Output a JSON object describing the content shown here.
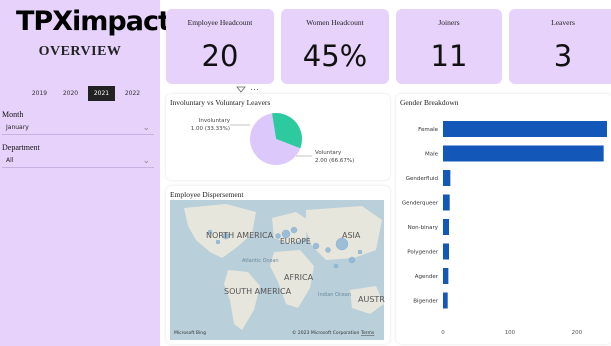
{
  "brand": {
    "logo_text": "TPXimpact",
    "section_title": "OVERVIEW"
  },
  "filters": {
    "years": [
      "2019",
      "2020",
      "2021",
      "2022"
    ],
    "selected_year": "2021",
    "month": {
      "label": "Month",
      "value": "January"
    },
    "department": {
      "label": "Department",
      "value": "All"
    }
  },
  "kpis": [
    {
      "title": "Employee Headcount",
      "value": "20"
    },
    {
      "title": "Women Headcount",
      "value": "45%"
    },
    {
      "title": "Joiners",
      "value": "11"
    },
    {
      "title": "Leavers",
      "value": "3"
    }
  ],
  "colors": {
    "accent": "#e6d2fb",
    "involuntary": "#2dc99f",
    "voluntary": "#dcc8fb",
    "bar": "#1357b8"
  },
  "pie_panel": {
    "title": "Involuntary vs Voluntary Leavers",
    "slices": [
      {
        "name": "Involuntary",
        "value": 1,
        "label": "1.00 (33.33%)"
      },
      {
        "name": "Voluntary",
        "value": 2,
        "label": "2.00 (66.67%)"
      }
    ]
  },
  "map_panel": {
    "title": "Employee Dispersement",
    "labels": {
      "north_america": "NORTH AMERICA",
      "europe": "EUROPE",
      "asia": "ASIA",
      "africa": "AFRICA",
      "south_america": "SOUTH AMERICA",
      "australia": "AUSTR",
      "atlantic": "Atlantic Ocean",
      "indian": "Indian Ocean"
    },
    "attribution": "Microsoft Bing",
    "copyright": "© 2023 Microsoft Corporation",
    "terms": "Terms"
  },
  "chart_data": {
    "type": "bar",
    "title": "Gender Breakdown",
    "orientation": "horizontal",
    "categories": [
      "Female",
      "Male",
      "Genderfluid",
      "Genderqueer",
      "Non-binary",
      "Polygender",
      "Agender",
      "Bigender"
    ],
    "values": [
      245,
      240,
      11,
      10,
      9,
      9,
      8,
      7
    ],
    "xticks": [
      "0",
      "100",
      "200"
    ],
    "xlim": [
      0,
      245
    ]
  }
}
